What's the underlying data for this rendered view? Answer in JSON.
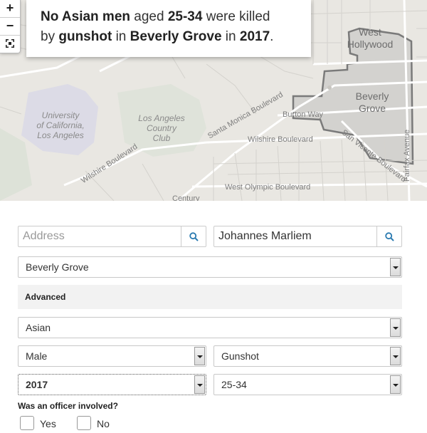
{
  "map": {
    "zoom_in": "+",
    "zoom_out": "−",
    "fullscreen_icon": "fullscreen-icon",
    "labels": {
      "west_hollywood_1": "West",
      "west_hollywood_2": "Hollywood",
      "beverly_grove_1": "Beverly",
      "beverly_grove_2": "Grove",
      "ucla_1": "University",
      "ucla_2": "of California,",
      "ucla_3": "Los Angeles",
      "lacc_1": "Los Angeles",
      "lacc_2": "Country",
      "lacc_3": "Club",
      "burton_way": "Burton Way",
      "santa_monica_blvd": "Santa Monica Boulevard",
      "wilshire_blvd_1": "Wilshire Boulevard",
      "wilshire_blvd_2": "Wilshire Boulevard",
      "san_vicente_blvd": "San Vicente Boulevard",
      "fairfax_ave": "Fairfax Avenue",
      "west_olympic_blvd": "West Olympic Boulevard",
      "century": "Century"
    }
  },
  "headline": {
    "part1": "No Asian men",
    "part2": " aged ",
    "part3": "25-34",
    "part4": " were killed",
    "part5": "by ",
    "part6": "gunshot",
    "part7": " in ",
    "part8": "Beverly Grove",
    "part9": " in ",
    "part10": "2017",
    "part11": "."
  },
  "form": {
    "address_placeholder": "Address",
    "address_value": "",
    "name_value": "Johannes Marliem",
    "search_icon": "search-icon",
    "neighborhood": "Beverly Grove",
    "advanced_label": "Advanced",
    "race": "Asian",
    "gender": "Male",
    "cause": "Gunshot",
    "year": "2017",
    "age": "25-34",
    "officer_question": "Was an officer involved?",
    "yes_label": "Yes",
    "no_label": "No"
  },
  "colors": {
    "map_bg": "#e9e7e2",
    "neighborhood_fill": "#cfcecb",
    "neighborhood_stroke": "#7a7a7a",
    "search_icon": "#2a7ab0"
  }
}
